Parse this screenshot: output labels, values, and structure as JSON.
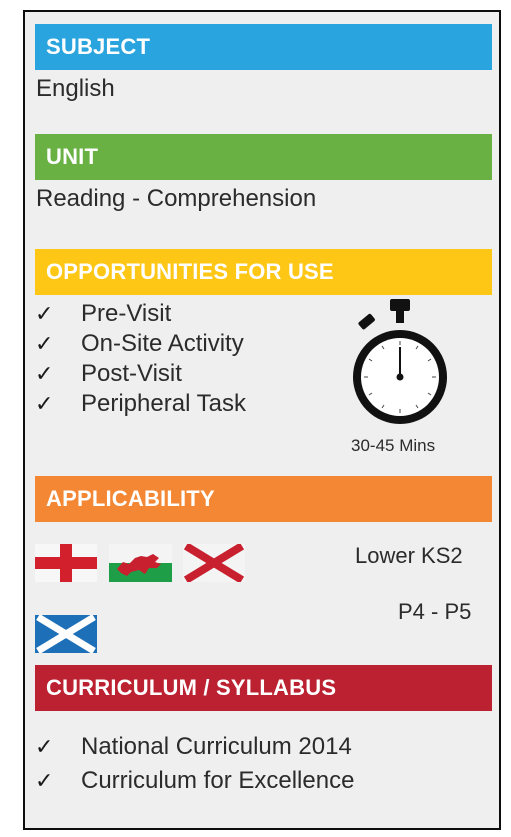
{
  "colors": {
    "subject": "#2aa4de",
    "unit": "#69b143",
    "opportunities": "#fec715",
    "applicability": "#f48734",
    "curriculum": "#bb2130",
    "card_background": "#efeff0"
  },
  "subject": {
    "heading": "SUBJECT",
    "value": "English"
  },
  "unit": {
    "heading": "UNIT",
    "value": "Reading - Comprehension"
  },
  "opportunities": {
    "heading": "OPPORTUNITIES FOR USE",
    "check_mark": "✓",
    "items": [
      "Pre-Visit",
      "On-Site Activity",
      "Post-Visit",
      "Peripheral Task"
    ],
    "timer_icon": "stopwatch-icon",
    "duration": "30-45 Mins"
  },
  "applicability": {
    "heading": "APPLICABILITY",
    "row1_flags": [
      "england-flag-icon",
      "wales-flag-icon",
      "northern-ireland-flag-icon"
    ],
    "row1_level": "Lower KS2",
    "row2_flags": [
      "scotland-flag-icon"
    ],
    "row2_level": "P4 - P5"
  },
  "curriculum": {
    "heading": "CURRICULUM / SYLLABUS",
    "check_mark": "✓",
    "items": [
      "National Curriculum 2014",
      "Curriculum for Excellence"
    ]
  }
}
